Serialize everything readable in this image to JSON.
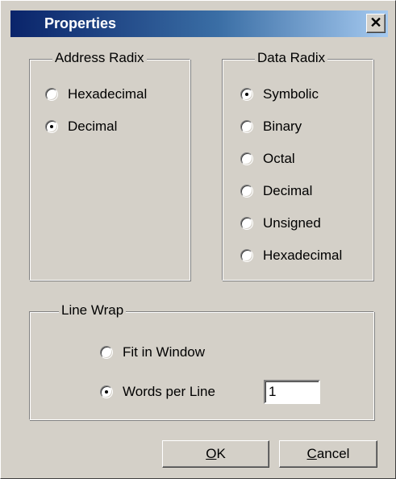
{
  "window": {
    "title": "Properties",
    "close_glyph": "✕"
  },
  "address_radix": {
    "legend": "Address Radix",
    "options": [
      {
        "label": "Hexadecimal",
        "checked": false
      },
      {
        "label": "Decimal",
        "checked": true
      }
    ]
  },
  "data_radix": {
    "legend": "Data Radix",
    "options": [
      {
        "label": "Symbolic",
        "checked": true
      },
      {
        "label": "Binary",
        "checked": false
      },
      {
        "label": "Octal",
        "checked": false
      },
      {
        "label": "Decimal",
        "checked": false
      },
      {
        "label": "Unsigned",
        "checked": false
      },
      {
        "label": "Hexadecimal",
        "checked": false
      }
    ]
  },
  "line_wrap": {
    "legend": "Line Wrap",
    "options": [
      {
        "label": "Fit in Window",
        "checked": false
      },
      {
        "label": "Words per Line",
        "checked": true
      }
    ],
    "words_per_line_value": "1"
  },
  "buttons": {
    "ok": {
      "accel": "O",
      "rest": "K"
    },
    "cancel": {
      "accel": "C",
      "rest": "ancel"
    }
  }
}
